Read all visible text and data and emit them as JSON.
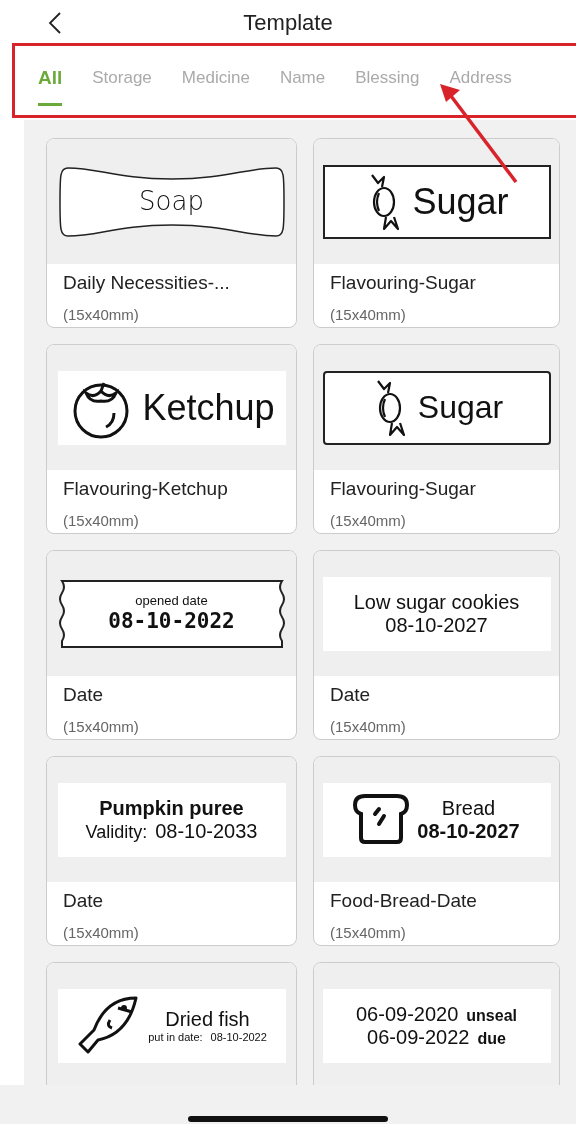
{
  "header": {
    "title": "Template"
  },
  "tabs": [
    {
      "label": "All",
      "selected": true
    },
    {
      "label": "Storage",
      "selected": false
    },
    {
      "label": "Medicine",
      "selected": false
    },
    {
      "label": "Name",
      "selected": false
    },
    {
      "label": "Blessing",
      "selected": false
    },
    {
      "label": "Address",
      "selected": false
    }
  ],
  "templates": [
    {
      "title": "Daily Necessities-...",
      "size": "(15x40mm)",
      "label": {
        "kind": "soap",
        "lines": [
          [
            "Soap"
          ]
        ]
      }
    },
    {
      "title": "Flavouring-Sugar",
      "size": "(15x40mm)",
      "label": {
        "kind": "candy",
        "lines": [
          [
            "Sugar"
          ]
        ]
      }
    },
    {
      "title": "Flavouring-Ketchup",
      "size": "(15x40mm)",
      "label": {
        "kind": "tomato",
        "lines": [
          [
            "Ketchup"
          ]
        ]
      }
    },
    {
      "title": "Flavouring-Sugar",
      "size": "(15x40mm)",
      "label": {
        "kind": "candybox",
        "lines": [
          [
            "Sugar"
          ]
        ]
      }
    },
    {
      "title": "Date",
      "size": "(15x40mm)",
      "label": {
        "kind": "ticket",
        "lines": [
          [
            "opened date"
          ],
          [
            "08-10-2022"
          ]
        ]
      }
    },
    {
      "title": "Date",
      "size": "(15x40mm)",
      "label": {
        "kind": "plain",
        "lines": [
          [
            "Low sugar cookies"
          ],
          [
            "08-10-2027"
          ]
        ]
      }
    },
    {
      "title": "Date",
      "size": "(15x40mm)",
      "label": {
        "kind": "validity",
        "lines": [
          [
            "Pumpkin puree"
          ],
          [
            "Validity:",
            "08-10-2033"
          ]
        ]
      }
    },
    {
      "title": "Food-Bread-Date",
      "size": "(15x40mm)",
      "label": {
        "kind": "bread",
        "lines": [
          [
            "Bread"
          ],
          [
            "08-10-2027"
          ]
        ]
      }
    },
    {
      "label": {
        "kind": "fish",
        "lines": [
          [
            "Dried fish"
          ],
          [
            "put in date:",
            "08-10-2022"
          ]
        ]
      }
    },
    {
      "label": {
        "kind": "pairs",
        "lines": [
          [
            "06-09-2020",
            "unseal"
          ],
          [
            "06-09-2022",
            "due"
          ]
        ]
      }
    }
  ]
}
